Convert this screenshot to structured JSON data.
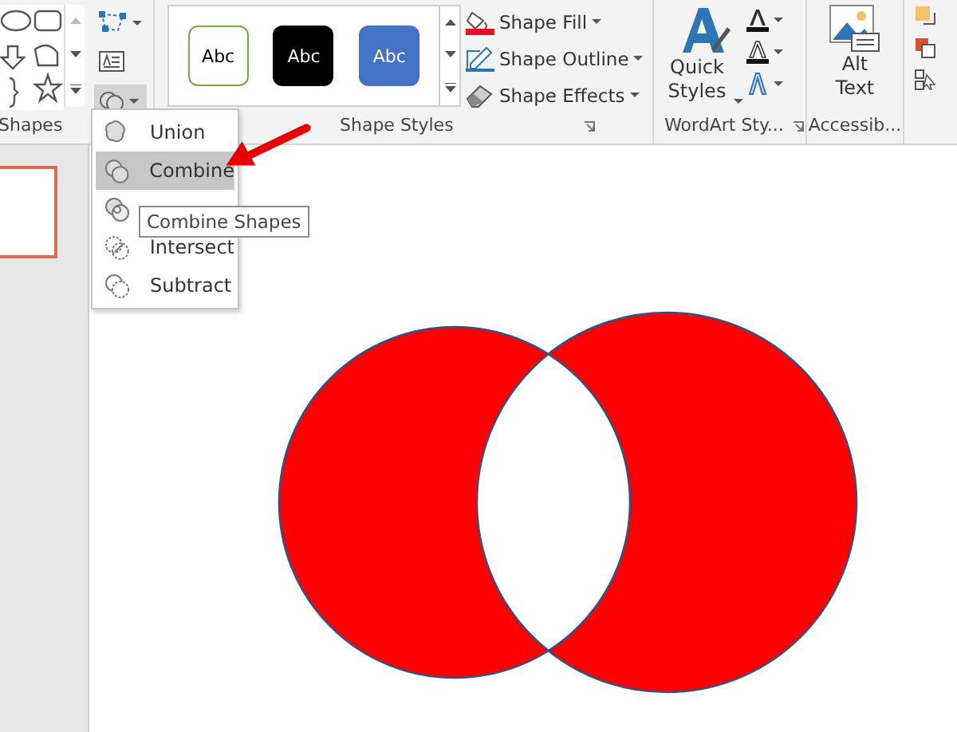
{
  "ribbon": {
    "shapes_group": {
      "label": "Shapes"
    },
    "shape_styles": {
      "label": "Shape Styles",
      "presets": [
        {
          "label": "Abc",
          "kind": "outline"
        },
        {
          "label": "Abc",
          "kind": "dark"
        },
        {
          "label": "Abc",
          "kind": "blue"
        }
      ],
      "commands": [
        {
          "label": "Shape Fill",
          "kind": "fill"
        },
        {
          "label": "Shape Outline",
          "kind": "outline"
        },
        {
          "label": "Shape Effects",
          "kind": "effects"
        }
      ]
    },
    "wordart": {
      "label": "WordArt Sty...",
      "quick_styles": "Quick Styles"
    },
    "accessibility": {
      "label": "Accessib...",
      "button": "Alt Text"
    }
  },
  "merge_menu": {
    "items": [
      {
        "kind": "union",
        "label": "Union",
        "selected": false
      },
      {
        "kind": "combine",
        "label": "Combine",
        "selected": true
      },
      {
        "kind": "fragment",
        "selected": false
      },
      {
        "kind": "intersect",
        "label": "Intersect",
        "selected": false
      },
      {
        "kind": "subtract",
        "label": "Subtract",
        "selected": false
      }
    ]
  },
  "tooltip": "Combine Shapes"
}
